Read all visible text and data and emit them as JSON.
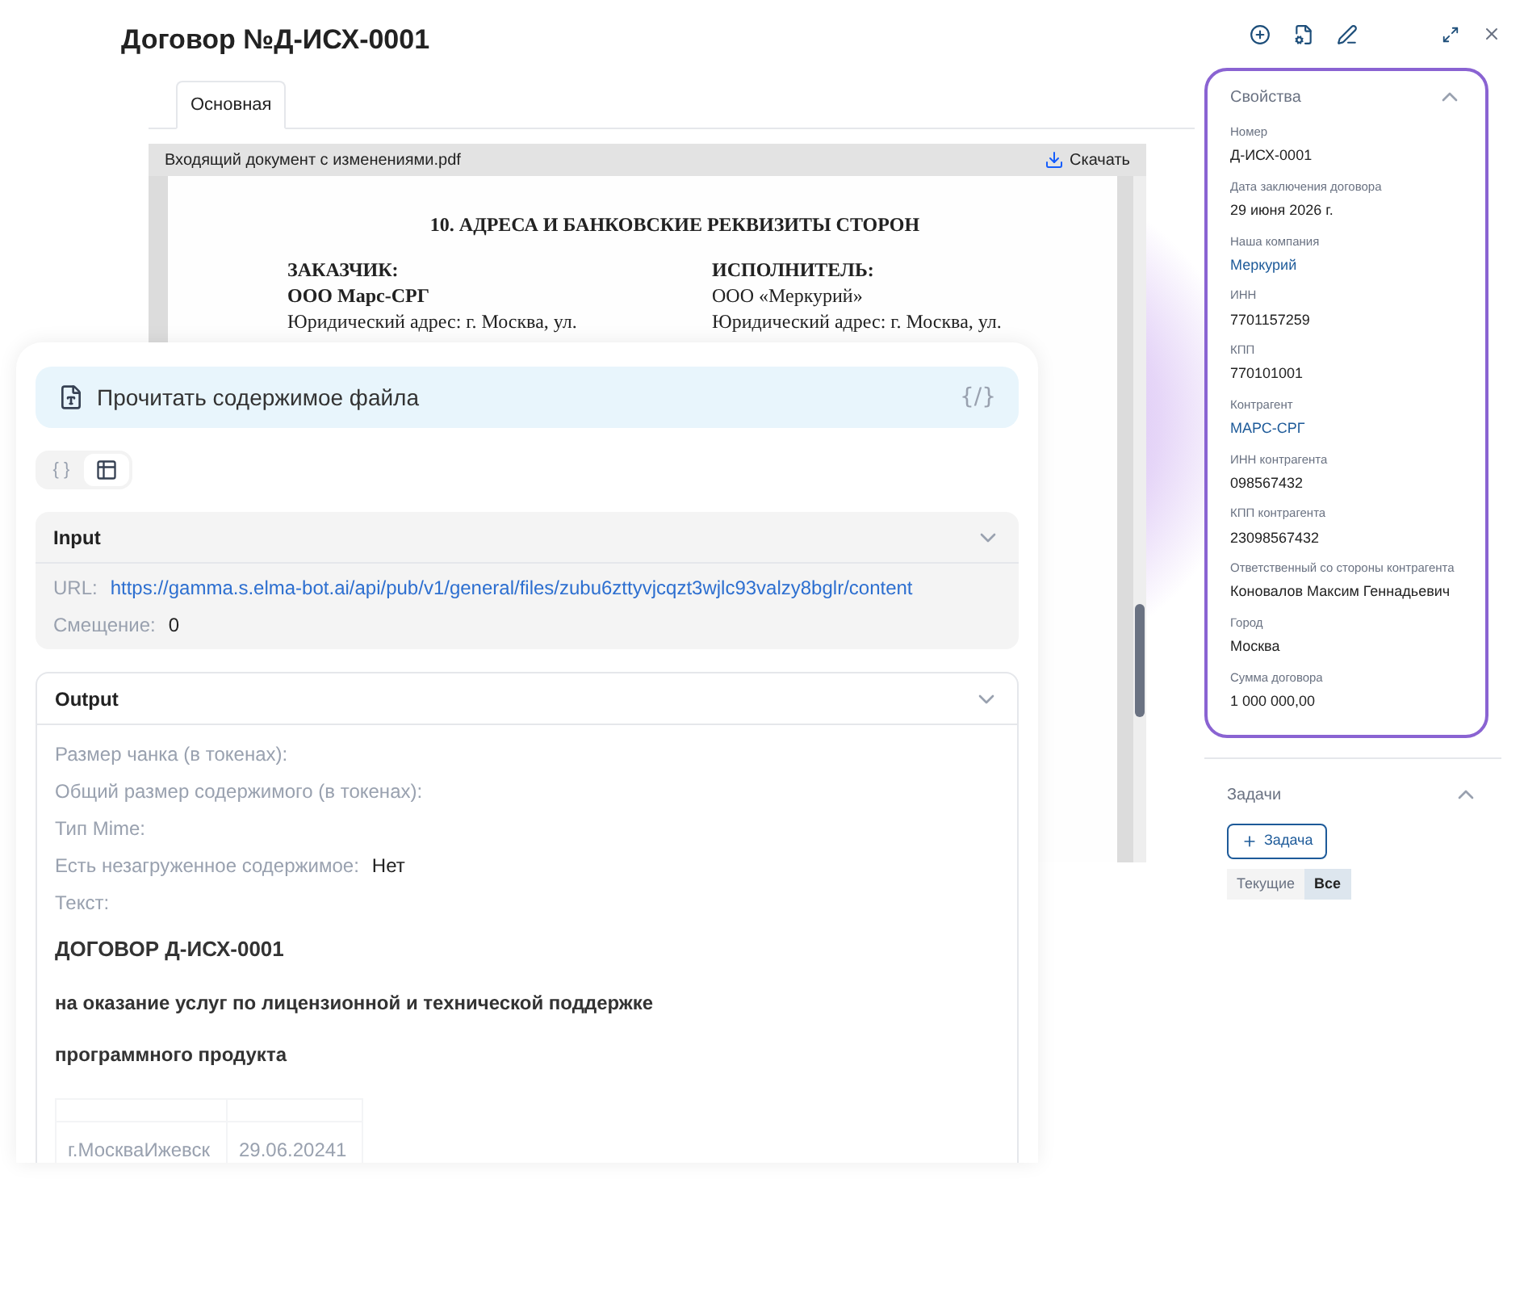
{
  "window": {
    "title": "Договор №Д-ИСХ-0001"
  },
  "tabs": [
    {
      "label": "Основная",
      "selected": true
    }
  ],
  "viewer": {
    "file_name": "Входящий документ с изменениями.pdf",
    "download": "Скачать",
    "document": {
      "heading": "10. АДРЕСА И БАНКОВСКИЕ РЕКВИЗИТЫ СТОРОН",
      "columns": [
        {
          "role": "ЗАКАЗЧИК:",
          "company": "ООО Марс-СРГ",
          "address": "Юридический адрес: г. Москва, ул."
        },
        {
          "role": "ИСПОЛНИТЕЛЬ:",
          "company": "ООО «Меркурий»",
          "address": "Юридический адрес: г. Москва, ул."
        }
      ]
    }
  },
  "properties": {
    "title": "Свойства",
    "expanded": true,
    "fields": [
      {
        "label": "Номер",
        "value": "Д-ИСХ-0001",
        "kind": "text"
      },
      {
        "label": "Дата заключения договора",
        "value": "29 июня 2026 г.",
        "kind": "text"
      },
      {
        "label": "Наша компания",
        "value": "Меркурий",
        "kind": "link"
      },
      {
        "label": "ИНН",
        "value": "7701157259",
        "kind": "text"
      },
      {
        "label": "КПП",
        "value": "770101001",
        "kind": "text"
      },
      {
        "label": "Контрагент",
        "value": "МАРС-СРГ",
        "kind": "link"
      },
      {
        "label": "ИНН контрагента",
        "value": "098567432",
        "kind": "text"
      },
      {
        "label": "КПП контрагента",
        "value": "23098567432",
        "kind": "text"
      },
      {
        "label": "Ответственный со стороны контрагента",
        "value": "Коновалов Максим Геннадьевич",
        "kind": "text"
      },
      {
        "label": "Город",
        "value": "Москва",
        "kind": "text"
      },
      {
        "label": "Сумма договора",
        "value": "1 000 000,00",
        "kind": "text"
      }
    ]
  },
  "tasks": {
    "title": "Задачи",
    "expanded": true,
    "add_button": "Задача",
    "filters": [
      {
        "label": "Текущие",
        "selected": false
      },
      {
        "label": "Все",
        "selected": true
      }
    ]
  },
  "tool_card": {
    "title": "Прочитать содержимое файла",
    "code_badge": "{/}",
    "view_modes": [
      {
        "kind": "json",
        "label": "{ }",
        "selected": false
      },
      {
        "kind": "table",
        "selected": true
      }
    ],
    "input": {
      "title": "Input",
      "expanded": true,
      "rows": [
        {
          "label": "URL:",
          "value": "https://gamma.s.elma-bot.ai/api/pub/v1/general/files/zubu6zttyvjcqzt3wjlc93valzy8bglr/content",
          "kind": "link"
        },
        {
          "label": "Смещение:",
          "value": "0",
          "kind": "text"
        }
      ]
    },
    "output": {
      "title": "Output",
      "expanded": true,
      "rows": [
        {
          "label": "Размер чанка (в токенах):"
        },
        {
          "label": "Общий размер содержимого (в токенах):"
        },
        {
          "label": "Тип Mime:"
        },
        {
          "label": "Есть незагруженное содержимое:",
          "value": "Нет"
        },
        {
          "label": "Текст:"
        }
      ],
      "text_lines": [
        "ДОГОВОР Д-ИСХ-0001",
        "на оказание услуг по лицензионной и технической поддержке",
        "программного продукта"
      ],
      "table_rows": [
        [
          "г.МоскваИжевск",
          "29.06.20241"
        ]
      ]
    }
  }
}
